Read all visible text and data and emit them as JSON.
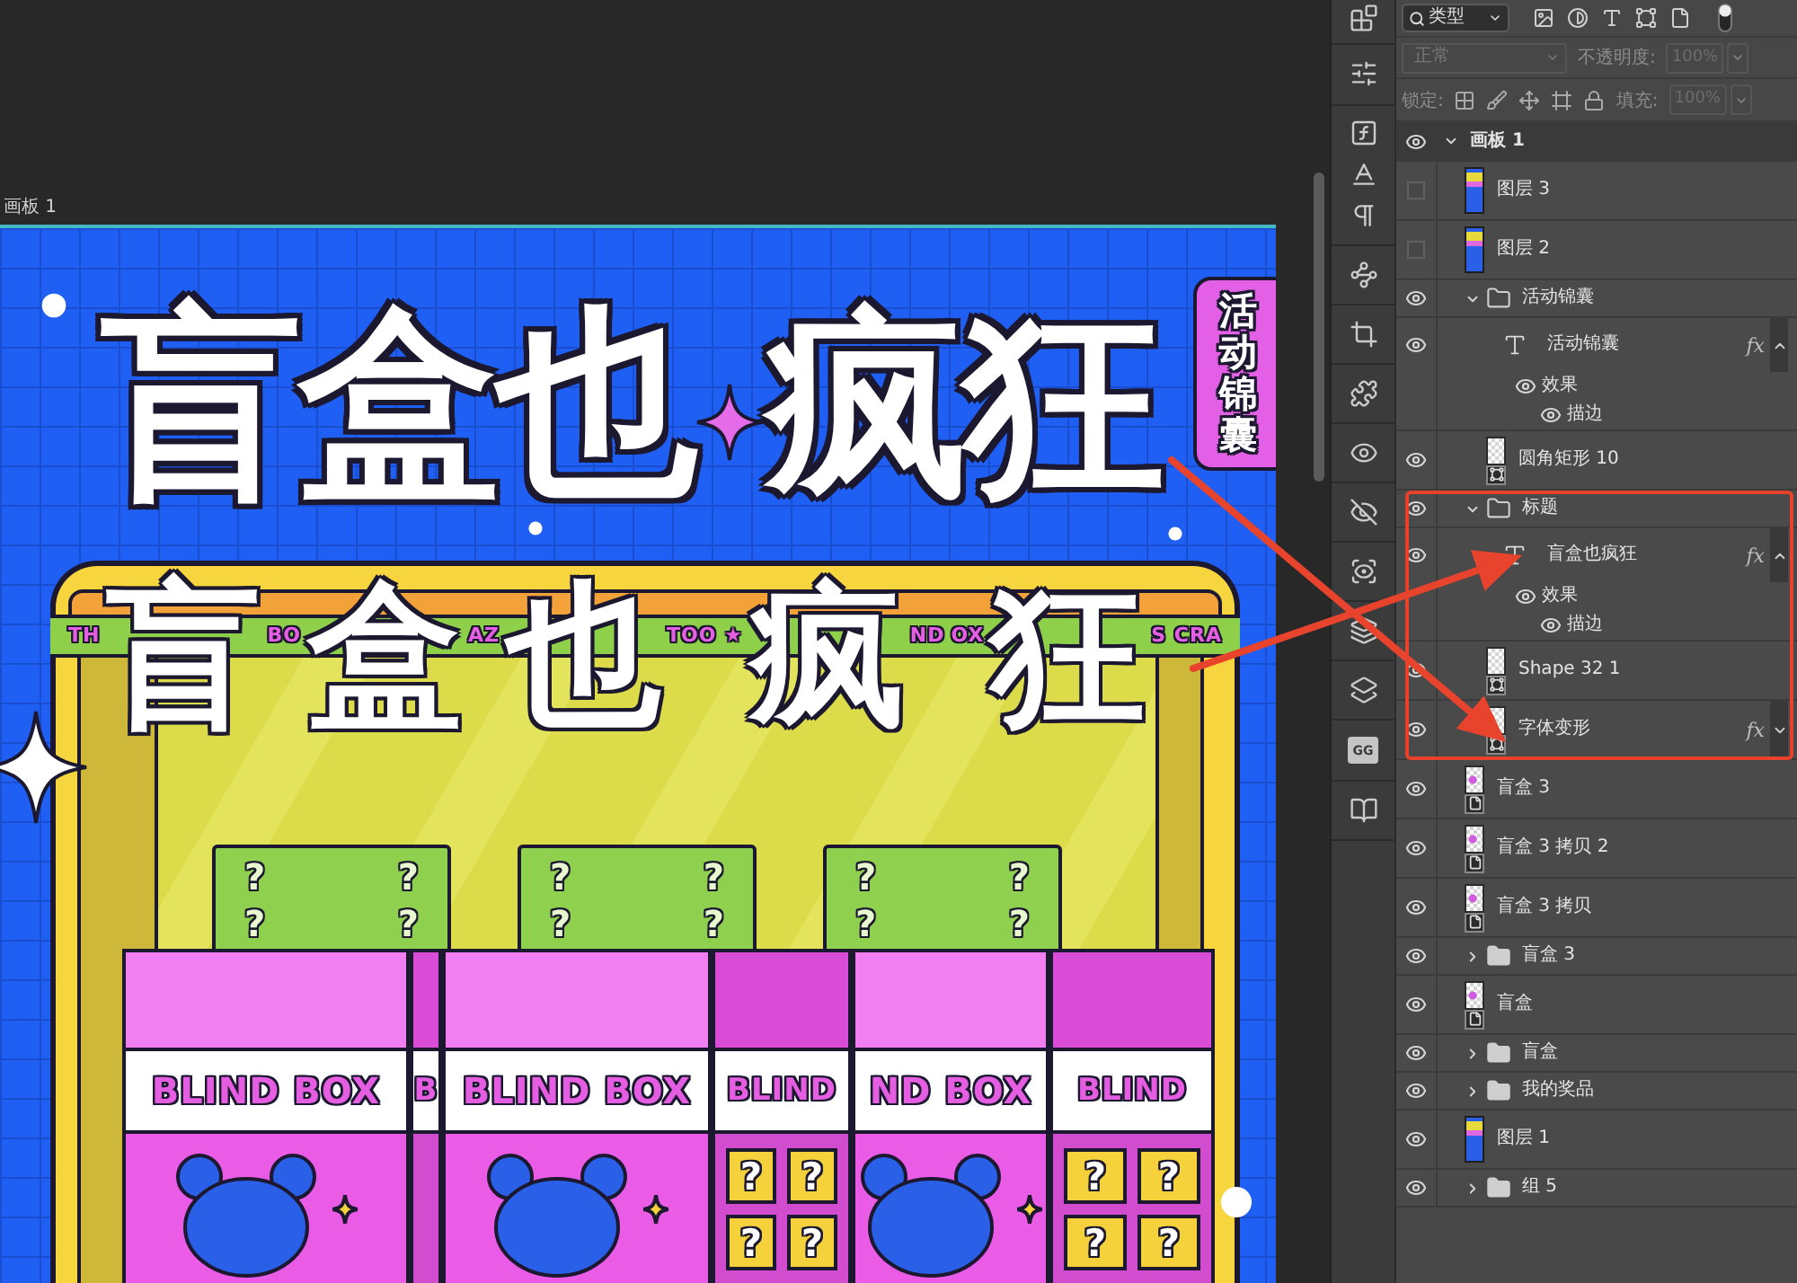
{
  "canvas": {
    "tab_label": "画板 1"
  },
  "artwork": {
    "title": [
      {
        "kind": "text",
        "text": "盲盒也"
      },
      {
        "kind": "sparkle"
      },
      {
        "kind": "text",
        "text": "疯狂"
      }
    ],
    "tag": "活动锦囊",
    "banner": [
      {
        "kind": "strip",
        "text": "TH"
      },
      {
        "kind": "title",
        "text": "盲"
      },
      {
        "kind": "strip",
        "text": "BO"
      },
      {
        "kind": "title",
        "text": "盒"
      },
      {
        "kind": "strip",
        "text": "AZ"
      },
      {
        "kind": "title",
        "text": "也"
      },
      {
        "kind": "strip",
        "text": "TOO ★"
      },
      {
        "kind": "title",
        "text": "疯"
      },
      {
        "kind": "strip",
        "text": "ND"
      },
      {
        "kind": "strip",
        "text": "OX"
      },
      {
        "kind": "title",
        "text": "狂"
      },
      {
        "kind": "strip",
        "text": "S CRA"
      }
    ],
    "gift_boxes": [
      {
        "marks": [
          "?",
          "?",
          "?",
          "?"
        ]
      },
      {
        "marks": [
          "?",
          "?",
          "?",
          "?"
        ]
      },
      {
        "marks": [
          "?",
          "?",
          "?",
          "?"
        ]
      }
    ],
    "blind_boxes": [
      {
        "front_label": "BLIND BOX",
        "side_label": "B"
      },
      {
        "front_label": "BLIND BOX",
        "side_label": "BLIND",
        "tiles": [
          "?",
          "?",
          "?",
          "?"
        ]
      },
      {
        "front_label": "ND BOX",
        "side_label": "BLIND",
        "tiles": [
          "?",
          "?",
          "?",
          "?"
        ]
      }
    ]
  },
  "toolbar": {
    "tile_label": "GG"
  },
  "layers_panel": {
    "filter": {
      "label": "类型",
      "on": true
    },
    "disabled": true,
    "blend_mode": {
      "value": "正常"
    },
    "opacity": {
      "label": "不透明度:",
      "value": "100%"
    },
    "lock": {
      "label": "锁定:"
    },
    "fill": {
      "label": "填充:",
      "value": "100%"
    },
    "layers": [
      {
        "name": "画板 1",
        "kind": "artboard",
        "visible": true,
        "expanded": true,
        "selected": false,
        "children": [
          {
            "name": "图层 3",
            "kind": "pixel",
            "visible": false,
            "selected": false
          },
          {
            "name": "图层 2",
            "kind": "pixel",
            "visible": false,
            "selected": false
          },
          {
            "name": "活动锦囊",
            "kind": "group",
            "visible": true,
            "expanded": true,
            "selected": false,
            "children": [
              {
                "name": "活动锦囊",
                "kind": "text",
                "visible": true,
                "selected": false,
                "fx": "fx",
                "effects_expanded": true,
                "effects": {
                  "label": "效果",
                  "visible": true,
                  "items": [
                    {
                      "name": "描边",
                      "visible": true
                    }
                  ]
                }
              },
              {
                "name": "圆角矩形 10",
                "kind": "shape",
                "visible": true,
                "selected": false
              }
            ]
          },
          {
            "name": "标题",
            "kind": "group",
            "visible": true,
            "expanded": true,
            "selected": false,
            "highlighted": true,
            "children": [
              {
                "name": "盲盒也疯狂",
                "kind": "text",
                "visible": true,
                "selected": false,
                "fx": "fx",
                "effects_expanded": true,
                "effects": {
                  "label": "效果",
                  "visible": true,
                  "items": [
                    {
                      "name": "描边",
                      "visible": true
                    }
                  ]
                }
              },
              {
                "name": "Shape 32 1",
                "kind": "shape",
                "visible": true,
                "selected": false
              },
              {
                "name": "字体变形",
                "kind": "shape",
                "visible": true,
                "selected": false,
                "fx": "fx",
                "effects_expanded": false
              }
            ]
          },
          {
            "name": "盲盒 3",
            "kind": "smart",
            "visible": true,
            "selected": false
          },
          {
            "name": "盲盒 3 拷贝 2",
            "kind": "smart",
            "visible": true,
            "selected": false
          },
          {
            "name": "盲盒 3 拷贝",
            "kind": "smart",
            "visible": true,
            "selected": false
          },
          {
            "name": "盲盒 3",
            "kind": "group",
            "visible": true,
            "expanded": false,
            "selected": false
          },
          {
            "name": "盲盒",
            "kind": "smart",
            "visible": true,
            "selected": false
          },
          {
            "name": "盲盒",
            "kind": "group",
            "visible": true,
            "expanded": false,
            "selected": false
          },
          {
            "name": "我的奖品",
            "kind": "group",
            "visible": true,
            "expanded": false,
            "selected": false
          },
          {
            "name": "图层 1",
            "kind": "pixel",
            "visible": true,
            "selected": false
          },
          {
            "name": "组 5",
            "kind": "group",
            "visible": true,
            "expanded": false,
            "selected": false
          }
        ]
      }
    ]
  }
}
